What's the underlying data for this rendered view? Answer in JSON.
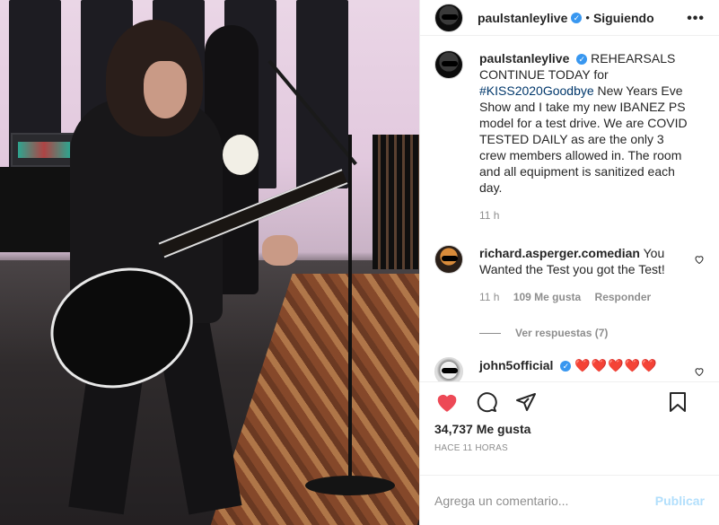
{
  "header": {
    "username": "paulstanleylive",
    "separator": "•",
    "follow_label": "Siguiendo",
    "more_label": "•••"
  },
  "caption": {
    "username": "paulstanleylive",
    "text_before": "REHEARSALS CONTINUE TODAY for ",
    "hashtag": "#KISS2020Goodbye",
    "text_after": " New Years Eve Show and I take my new IBANEZ PS model for a test drive. We are COVID TESTED DAILY as are the only 3 crew members allowed in. The room and all equipment is sanitized each day.",
    "time": "11 h"
  },
  "comments": [
    {
      "username": "richard.asperger.comedian",
      "text": "You Wanted the Test you got the Test!",
      "time": "11 h",
      "likes": "109 Me gusta",
      "reply_label": "Responder",
      "view_replies": "Ver respuestas (7)"
    },
    {
      "username": "john5official",
      "text": "❤️❤️❤️❤️❤️"
    }
  ],
  "actions": {
    "like_icon": "heart-filled-icon",
    "comment_icon": "comment-icon",
    "share_icon": "paper-plane-icon",
    "save_icon": "bookmark-icon"
  },
  "likes_count": "34,737 Me gusta",
  "posted_ago": "HACE 11 HORAS",
  "add_comment": {
    "placeholder": "Agrega un comentario...",
    "post_label": "Publicar"
  },
  "colors": {
    "like_red": "#ed4956",
    "verified_blue": "#3897f0",
    "post_disabled": "#b2dffc",
    "hashtag": "#00376b"
  }
}
